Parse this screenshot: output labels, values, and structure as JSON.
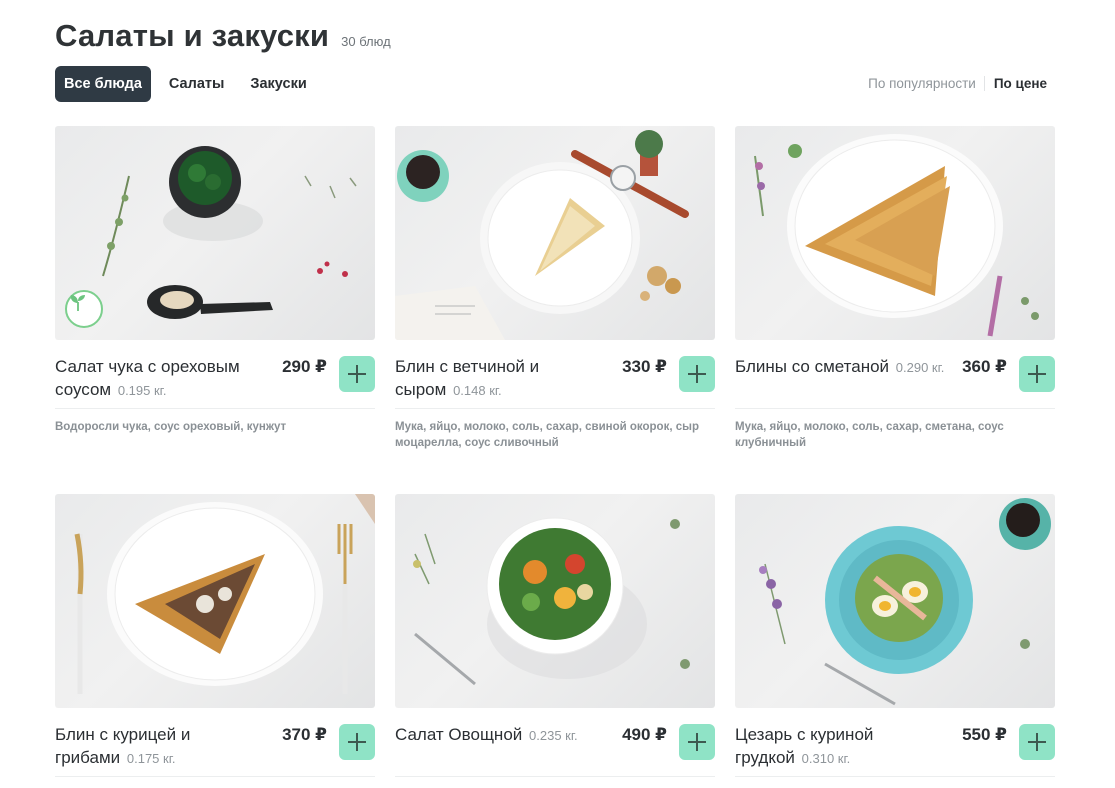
{
  "header": {
    "title": "Салаты и закуски",
    "count": "30 блюд"
  },
  "tabs": [
    {
      "label": "Все блюда",
      "active": true
    },
    {
      "label": "Салаты",
      "active": false
    },
    {
      "label": "Закуски",
      "active": false
    }
  ],
  "sort": {
    "popularity": "По популярности",
    "price": "По цене"
  },
  "colors": {
    "accent": "#8fe3c6",
    "active_tab": "#2f3a44",
    "veg_badge": "#7ccf8d"
  },
  "products": [
    {
      "name": "Салат чука с ореховым соусом",
      "weight": "0.195 кг.",
      "price": "290 ₽",
      "ingredients": "Водоросли чука, соус ореховый, кунжут",
      "badge": "leaf-icon"
    },
    {
      "name": "Блин с ветчиной и сыром",
      "weight": "0.148 кг.",
      "price": "330 ₽",
      "ingredients": "Мука, яйцо, молоко, соль, сахар, свиной окорок, сыр моцарелла, соус сливочный"
    },
    {
      "name": "Блины со сметаной",
      "weight": "0.290 кг.",
      "price": "360 ₽",
      "ingredients": "Мука, яйцо, молоко, соль, сахар, сметана, соус клубничный"
    },
    {
      "name": "Блин с курицей и грибами",
      "weight": "0.175 кг.",
      "price": "370 ₽",
      "ingredients": ""
    },
    {
      "name": "Салат Овощной",
      "weight": "0.235 кг.",
      "price": "490 ₽",
      "ingredients": ""
    },
    {
      "name": "Цезарь с куриной грудкой",
      "weight": "0.310 кг.",
      "price": "550 ₽",
      "ingredients": ""
    }
  ]
}
